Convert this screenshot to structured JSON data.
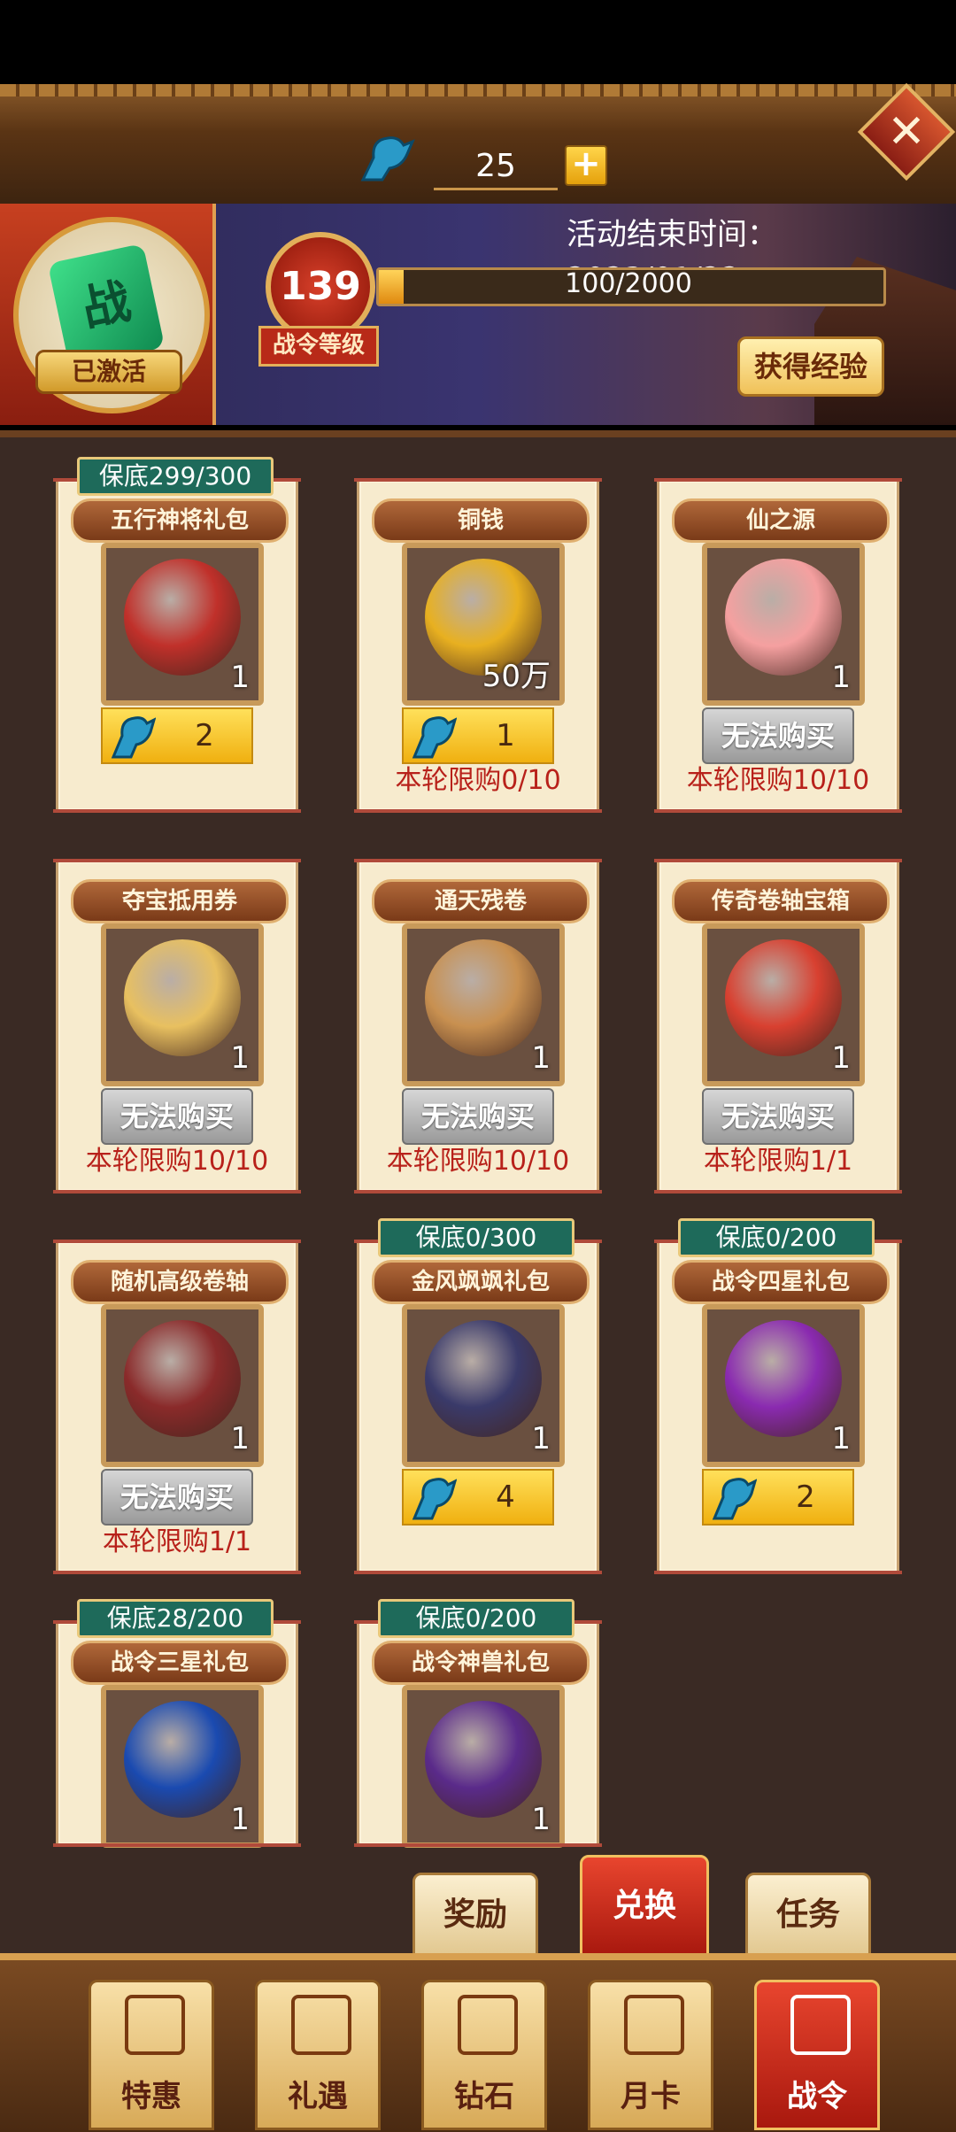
{
  "currency": {
    "value": "25",
    "plus": "+"
  },
  "close": "✕",
  "badge": {
    "glyph": "战",
    "status": "已激活"
  },
  "pass": {
    "level": "139",
    "level_label": "战令等级",
    "xp_text": "100/2000",
    "xp_fraction": 0.05
  },
  "event": {
    "end_time": "活动结束时间：2023/01/22"
  },
  "gain_xp_button": "获得经验",
  "items": [
    {
      "guarantee": "保底299/300",
      "name": "五行神将礼包",
      "qty": "1",
      "price": "2",
      "buyable": true,
      "limit": "",
      "color": "#c0302a"
    },
    {
      "guarantee": "",
      "name": "铜钱",
      "qty": "50万",
      "price": "1",
      "buyable": true,
      "limit": "本轮限购0/10",
      "color": "#e8b020"
    },
    {
      "guarantee": "",
      "name": "仙之源",
      "qty": "1",
      "price": "",
      "buyable": false,
      "cant_buy": "无法购买",
      "limit": "本轮限购10/10",
      "color": "#f5a0a0"
    },
    {
      "guarantee": "",
      "name": "夺宝抵用券",
      "qty": "1",
      "price": "",
      "buyable": false,
      "cant_buy": "无法购买",
      "limit": "本轮限购10/10",
      "color": "#e8c060"
    },
    {
      "guarantee": "",
      "name": "通天残卷",
      "qty": "1",
      "price": "",
      "buyable": false,
      "cant_buy": "无法购买",
      "limit": "本轮限购10/10",
      "color": "#c89050"
    },
    {
      "guarantee": "",
      "name": "传奇卷轴宝箱",
      "qty": "1",
      "price": "",
      "buyable": false,
      "cant_buy": "无法购买",
      "limit": "本轮限购1/1",
      "color": "#d84030"
    },
    {
      "guarantee": "",
      "name": "随机高级卷轴",
      "qty": "1",
      "price": "",
      "buyable": false,
      "cant_buy": "无法购买",
      "limit": "本轮限购1/1",
      "color": "#8a2a2a"
    },
    {
      "guarantee": "保底0/300",
      "name": "金风飒飒礼包",
      "qty": "1",
      "price": "4",
      "buyable": true,
      "limit": "",
      "color": "#3a3a6a"
    },
    {
      "guarantee": "保底0/200",
      "name": "战令四星礼包",
      "qty": "1",
      "price": "2",
      "buyable": true,
      "limit": "",
      "color": "#8a2ab0"
    },
    {
      "guarantee": "保底28/200",
      "name": "战令三星礼包",
      "qty": "1",
      "price": "",
      "buyable": true,
      "limit": "",
      "color": "#1a4ab0"
    },
    {
      "guarantee": "保底0/200",
      "name": "战令神兽礼包",
      "qty": "1",
      "price": "",
      "buyable": true,
      "limit": "",
      "color": "#5a2a8a"
    }
  ],
  "tabs": [
    "奖励",
    "兑换",
    "任务"
  ],
  "nav": [
    "特惠",
    "礼遇",
    "钻石",
    "月卡",
    "战令"
  ]
}
